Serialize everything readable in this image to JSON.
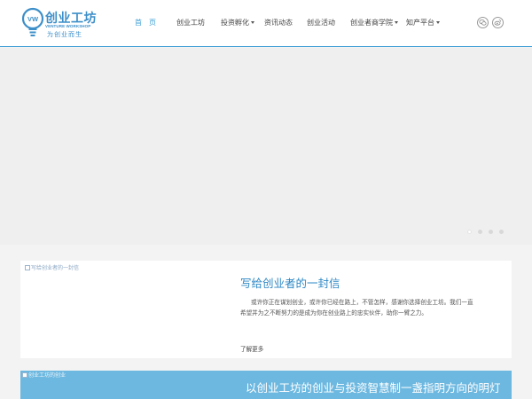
{
  "brand": {
    "mark": "VW",
    "name": "创业工坊",
    "name_en": "VENTURE WORKSHOP",
    "tagline": "为创业而生"
  },
  "nav": {
    "items": [
      {
        "label": "首　页",
        "active": true,
        "dropdown": false
      },
      {
        "label": "创业工坊",
        "active": false,
        "dropdown": false
      },
      {
        "label": "投资孵化",
        "active": false,
        "dropdown": true
      },
      {
        "label": "资讯动态",
        "active": false,
        "dropdown": false
      },
      {
        "label": "创业活动",
        "active": false,
        "dropdown": false
      },
      {
        "label": "创业者商学院",
        "active": false,
        "dropdown": true
      },
      {
        "label": "知产平台",
        "active": false,
        "dropdown": true
      }
    ],
    "social": [
      "wechat-icon",
      "weibo-icon"
    ]
  },
  "slider": {
    "dot_count": 4,
    "active_index": 0
  },
  "card1": {
    "image_alt": "写给创业者的一封信",
    "title": "写给创业者的一封信",
    "body": "或许你正在谋划创业，或许你已经在路上，不管怎样，感谢你选择创业工坊。我们一直希望并为之不断努力的是成为你在创业路上的忠实伙伴，助你一臂之力。",
    "more": "了解更多"
  },
  "card2": {
    "image_alt": "创业工坊的创业",
    "title": "以创业工坊的创业与投资智慧制一盏指明方向的明灯"
  },
  "colors": {
    "accent": "#3d9fd6",
    "brand": "#3d8fc9",
    "card2_bg": "#6db8e0"
  }
}
